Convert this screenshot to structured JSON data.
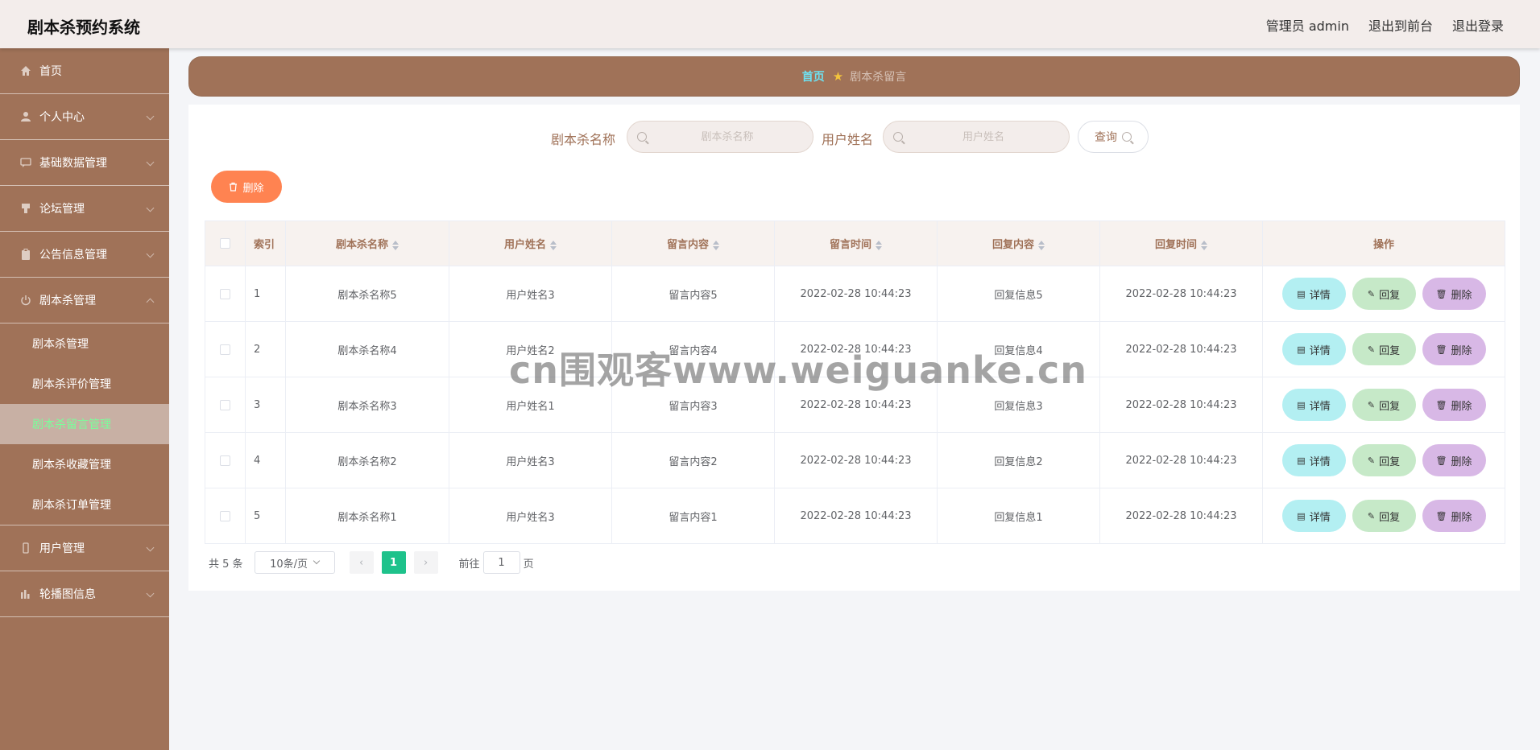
{
  "header": {
    "title": "剧本杀预约系统",
    "admin_label": "管理员 admin",
    "to_front": "退出到前台",
    "logout": "退出登录"
  },
  "sidebar": {
    "items": [
      {
        "label": "首页",
        "icon": "home-icon"
      },
      {
        "label": "个人中心",
        "icon": "user-icon"
      },
      {
        "label": "基础数据管理",
        "icon": "chat-icon"
      },
      {
        "label": "论坛管理",
        "icon": "forum-icon"
      },
      {
        "label": "公告信息管理",
        "icon": "clipboard-icon"
      },
      {
        "label": "剧本杀管理",
        "icon": "power-icon"
      },
      {
        "label": "用户管理",
        "icon": "phone-icon"
      },
      {
        "label": "轮播图信息",
        "icon": "bar-chart-icon"
      }
    ],
    "submenu": [
      "剧本杀管理",
      "剧本杀评价管理",
      "剧本杀留言管理",
      "剧本杀收藏管理",
      "剧本杀订单管理"
    ]
  },
  "breadcrumb": {
    "home": "首页",
    "current": "剧本杀留言"
  },
  "search": {
    "name_label": "剧本杀名称",
    "name_placeholder": "剧本杀名称",
    "user_label": "用户姓名",
    "user_placeholder": "用户姓名",
    "query_label": "查询"
  },
  "batch_delete_label": "删除",
  "table": {
    "headers": [
      "索引",
      "剧本杀名称",
      "用户姓名",
      "留言内容",
      "留言时间",
      "回复内容",
      "回复时间",
      "操作"
    ],
    "rows": [
      [
        "1",
        "剧本杀名称5",
        "用户姓名3",
        "留言内容5",
        "2022-02-28 10:44:23",
        "回复信息5",
        "2022-02-28 10:44:23"
      ],
      [
        "2",
        "剧本杀名称4",
        "用户姓名2",
        "留言内容4",
        "2022-02-28 10:44:23",
        "回复信息4",
        "2022-02-28 10:44:23"
      ],
      [
        "3",
        "剧本杀名称3",
        "用户姓名1",
        "留言内容3",
        "2022-02-28 10:44:23",
        "回复信息3",
        "2022-02-28 10:44:23"
      ],
      [
        "4",
        "剧本杀名称2",
        "用户姓名3",
        "留言内容2",
        "2022-02-28 10:44:23",
        "回复信息2",
        "2022-02-28 10:44:23"
      ],
      [
        "5",
        "剧本杀名称1",
        "用户姓名3",
        "留言内容1",
        "2022-02-28 10:44:23",
        "回复信息1",
        "2022-02-28 10:44:23"
      ]
    ],
    "actions": {
      "detail": "详情",
      "reply": "回复",
      "delete": "删除"
    }
  },
  "pagination": {
    "total": "共 5 条",
    "page_size": "10条/页",
    "current": "1",
    "goto_prefix": "前往",
    "goto_value": "1",
    "goto_suffix": "页"
  },
  "watermark": "cn围观客www.weiguanke.cn",
  "colors": {
    "sidebar": "#a07258",
    "header": "#f3edeb",
    "active_page": "#1ec28b",
    "detail_btn": "#b3eff2",
    "reply_btn": "#c6e9c8",
    "delete_btn": "#d8b8e6",
    "batch_delete": "#ff8351"
  }
}
